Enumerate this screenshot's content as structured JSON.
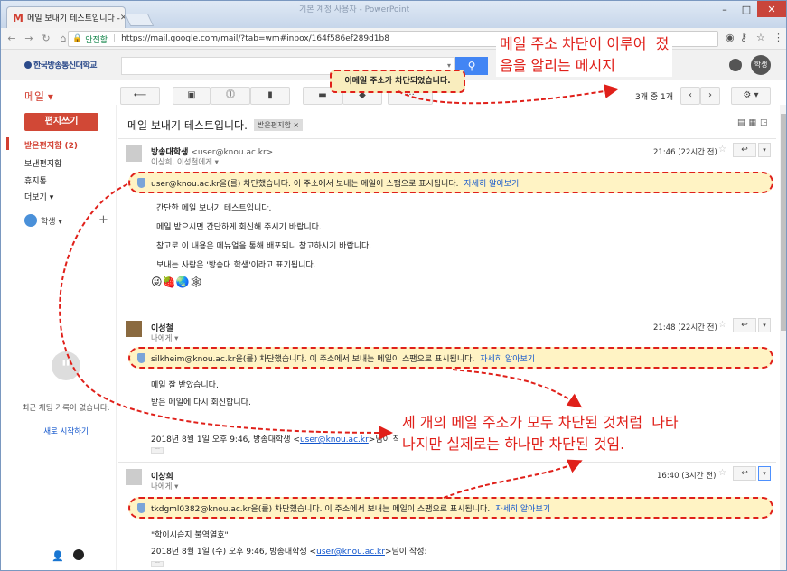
{
  "browser": {
    "tab_title": "메일 보내기 테스트입니다 - ",
    "window_title": "기본 계정 사용자 - PowerPoint",
    "secure_label": "안전함",
    "url": "https://mail.google.com/mail/?tab=wm#inbox/164f586ef289d1b8"
  },
  "gmail": {
    "logo_text": "한국방송통신대학교",
    "mail_label": "메일 ▾",
    "user_avatar": "학생",
    "count_text": "3개 중 1개",
    "toast": "이메일 주소가 차단되었습니다.",
    "sidebar": {
      "compose": "편지쓰기",
      "items": [
        "받은편지함 (2)",
        "보낸편지함",
        "휴지통",
        "더보기 ▾"
      ],
      "people": "학생 ▾",
      "chat_empty": "최근 채팅 기록이 없습니다.",
      "chat_start": "새로 시작하기"
    },
    "subject": "메일 보내기 테스트입니다.",
    "label_chip": "받은편지함 ×",
    "messages": [
      {
        "sender": "방송대학생",
        "sender_email": "<user@knou.ac.kr>",
        "to": "이상희, 이성철에게 ▾",
        "time": "21:46 (22시간 전)",
        "warning": "user@knou.ac.kr을(를) 차단했습니다. 이 주소에서 보내는 메일이 스팸으로 표시됩니다.",
        "more": "자세히 알아보기",
        "body": [
          "간단한 메일 보내기 테스트입니다.",
          "메일 받으시면 간단하게 회신해 주시기 바랍니다.",
          "참고로 이 내용은 메뉴얼을 통해 배포되니 참고하시기 바랍니다.",
          "보내는 사람은 '방송대 학생'이라고 표기됩니다."
        ],
        "emoji": "😜🍓🌏🕸"
      },
      {
        "sender": "이성철",
        "to": "나에게 ▾",
        "time": "21:48 (22시간 전)",
        "warning": "silkheim@knou.ac.kr을(를) 차단했습니다. 이 주소에서 보내는 메일이 스팸으로 표시됩니다.",
        "more": "자세히 알아보기",
        "body": [
          "메일 잘 받았습니다.",
          "받은 메일에 다시 회신합니다."
        ],
        "quote_prefix": "2018년 8월 1일 오후 9:46, 방송대학생 <",
        "quote_email": "user@knou.ac.kr",
        "quote_suffix": ">님이 작성:"
      },
      {
        "sender": "이상희",
        "to": "나에게 ▾",
        "time": "16:40 (3시간 전)",
        "warning": "tkdgml0382@knou.ac.kr을(를) 차단했습니다. 이 주소에서 보내는 메일이 스팸으로 표시됩니다.",
        "more": "자세히 알아보기",
        "body": [
          "\"학이시습지 불역열호\""
        ],
        "quote_prefix": "2018년 8월 1일 (수) 오후 9:46, 방송대학생 <",
        "quote_email": "user@knou.ac.kr",
        "quote_suffix": ">님이 작성:"
      }
    ]
  },
  "annotations": {
    "top": "메일 주소 차단이 이루어  졌\n음을 알리는 메시지",
    "middle": "세 개의 메일 주소가 모두 차단된 것처럼  나타\n나지만 실제로는 하나만 차단된 것임."
  },
  "colors": {
    "gmail_red": "#d23f31",
    "annotation_red": "#e0201a",
    "warning_bg": "#fff3c4",
    "search_blue": "#4285f4"
  }
}
